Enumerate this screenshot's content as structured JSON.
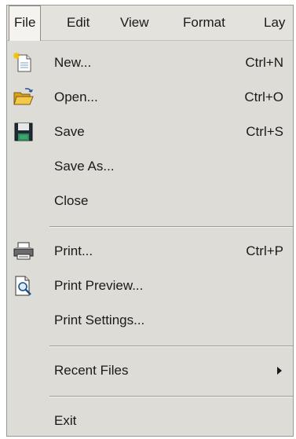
{
  "menubar": {
    "items": [
      "File",
      "Edit",
      "View",
      "Format",
      "Lay"
    ]
  },
  "file_menu": {
    "items": [
      {
        "label": "New...",
        "shortcut": "Ctrl+N",
        "icon": "new-document-icon"
      },
      {
        "label": "Open...",
        "shortcut": "Ctrl+O",
        "icon": "open-folder-icon"
      },
      {
        "label": "Save",
        "shortcut": "Ctrl+S",
        "icon": "floppy-disk-icon"
      },
      {
        "label": "Save As...",
        "shortcut": ""
      },
      {
        "label": "Close",
        "shortcut": ""
      },
      {
        "label": "Print...",
        "shortcut": "Ctrl+P",
        "icon": "printer-icon"
      },
      {
        "label": "Print Preview...",
        "shortcut": "",
        "icon": "print-preview-icon"
      },
      {
        "label": "Print Settings...",
        "shortcut": ""
      },
      {
        "label": "Recent Files",
        "has_submenu": true
      },
      {
        "label": "Exit",
        "shortcut": ""
      }
    ]
  },
  "colors": {
    "menu_background": "#dedcd6",
    "active_menu_background": "#f4f3ef"
  }
}
